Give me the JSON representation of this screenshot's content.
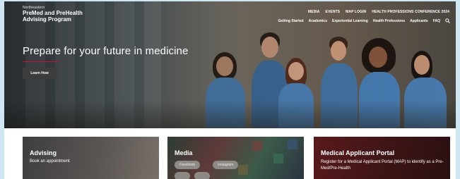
{
  "brand": {
    "top": "Northeastern",
    "line1": "PreMed and PreHealth",
    "line2": "Advising Program"
  },
  "utility_nav": [
    "MEDIA",
    "EVENTS",
    "MAP LOGIN",
    "HEALTH PROFESSIONS CONFERENCE 2024"
  ],
  "main_nav": [
    "Getting Started",
    "Academics",
    "Experiential Learning",
    "Health Professions",
    "Applicants",
    "FAQ"
  ],
  "hero": {
    "headline": "Prepare for your future in medicine",
    "button": "Learn How"
  },
  "cards": {
    "advising": {
      "title": "Advising",
      "subtitle": "Book an appointment"
    },
    "media": {
      "title": "Media",
      "pill1": "Facebook",
      "pill2": "Instagram"
    },
    "map": {
      "title": "Medical Applicant Portal",
      "desc": "Register for a Medical Applicant Portal (MAP) to identify as a Pre-Med/Pre-Health"
    }
  },
  "colors": {
    "accent_red": "#c8102e",
    "page_bg": "#cfe7f3"
  },
  "icons": [
    "search-icon"
  ]
}
